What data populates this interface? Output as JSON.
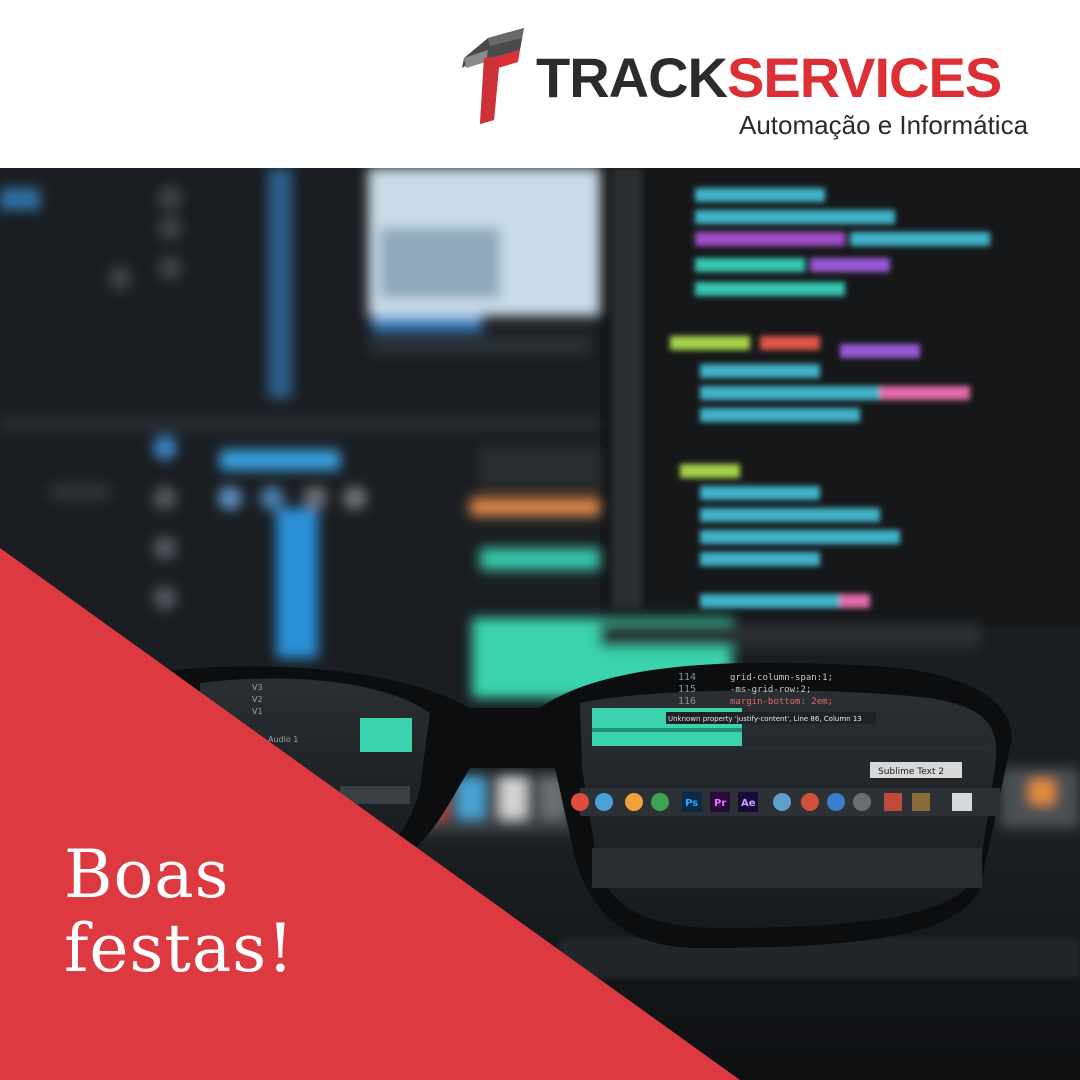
{
  "brand": {
    "name_part1": "TRACK",
    "name_part2": "SERVICES",
    "tagline": "Automação e Informática",
    "colors": {
      "accent_red": "#dc2f36",
      "dark_gray": "#2b2b2b"
    }
  },
  "photo": {
    "subject": "blurred-code-monitor-with-eyeglasses",
    "lens_caption": "Sublime Text 2",
    "lens_tooltip": "Unknown property 'justify-content', Line 86, Column 13",
    "lens_code": [
      "grid-column-span:1;",
      "-ms-grid-row:2;",
      "margin-bottom: 2em;"
    ],
    "lens_line_numbers": [
      "114",
      "115",
      "116"
    ],
    "lens_dock_badges": [
      "Ps",
      "Pr",
      "Ae"
    ],
    "lens_left_labels": [
      "V3",
      "V2",
      "V1",
      "Audio 1"
    ]
  },
  "greeting": {
    "line1": "Boas",
    "line2": "festas!"
  },
  "colors": {
    "background_white": "#ffffff",
    "photo_dark": "#15191d",
    "overlay_red": "#dc3a40"
  }
}
